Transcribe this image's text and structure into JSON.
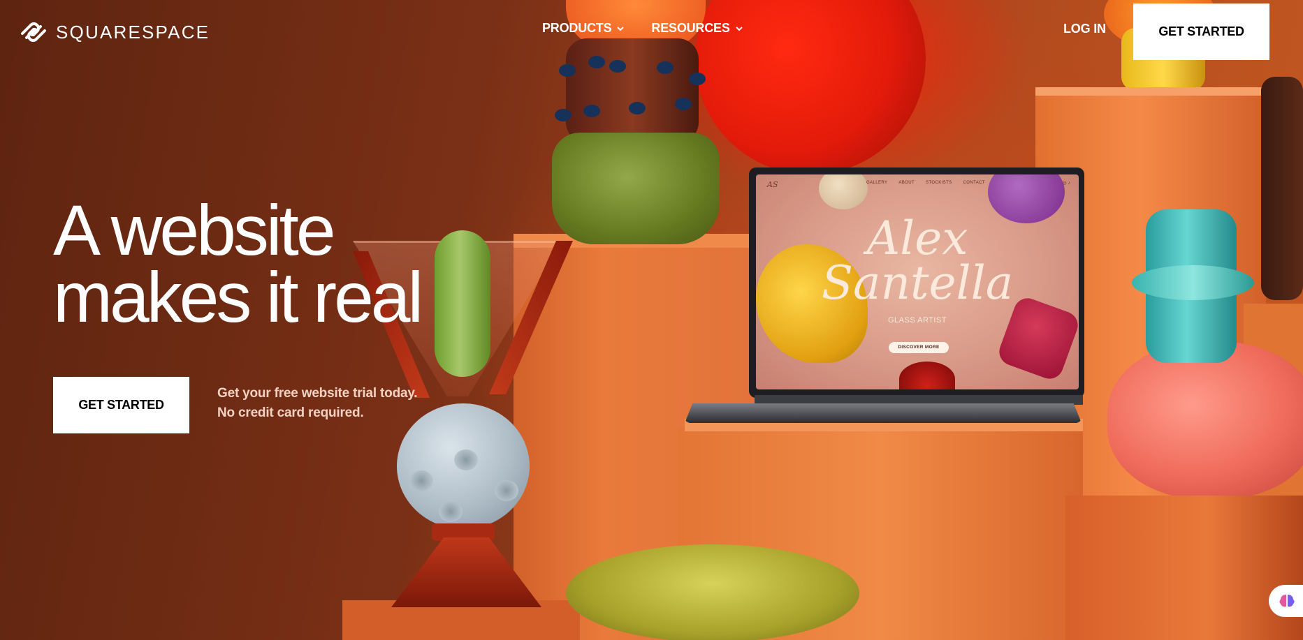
{
  "brand": {
    "name": "SQUARESPACE"
  },
  "nav": {
    "items": [
      {
        "label": "PRODUCTS"
      },
      {
        "label": "RESOURCES"
      }
    ],
    "login": "LOG IN",
    "cta": "GET STARTED"
  },
  "hero": {
    "title_line1": "A website",
    "title_line2": "makes it real",
    "cta": "GET STARTED",
    "note_line1": "Get your free website trial today.",
    "note_line2": "No credit card required."
  },
  "laptop": {
    "monogram": "AS",
    "nav": [
      "GALLERY",
      "ABOUT",
      "STOCKISTS",
      "CONTACT"
    ],
    "name_line1": "Alex",
    "name_line2": "Santella",
    "subtitle": "GLASS ARTIST",
    "button": "DISCOVER MORE"
  },
  "colors": {
    "background": "#7a3016",
    "accent_white": "#ffffff",
    "note_text": "#f3d2c4"
  },
  "icons": [
    "squarespace-logo-icon",
    "chevron-down-icon",
    "instagram-icon",
    "tiktok-icon",
    "assistant-brain-icon"
  ]
}
